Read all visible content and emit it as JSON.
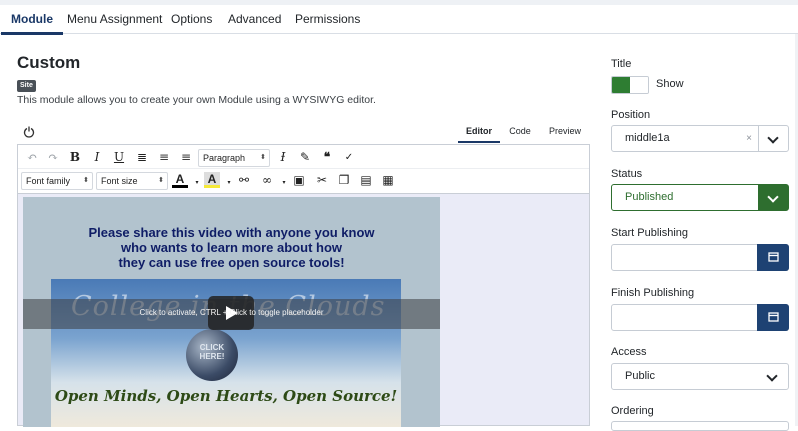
{
  "tabs": [
    {
      "label": "Module",
      "active": true
    },
    {
      "label": "Menu Assignment"
    },
    {
      "label": "Options"
    },
    {
      "label": "Advanced"
    },
    {
      "label": "Permissions"
    }
  ],
  "module": {
    "title": "Custom",
    "badge": "Site",
    "description": "This module allows you to create your own Module using a WYSIWYG editor."
  },
  "editor": {
    "tabs": {
      "editor": "Editor",
      "code": "Code",
      "preview": "Preview"
    },
    "block_format": "Paragraph",
    "font_family": "Font family",
    "font_size": "Font size",
    "icons": [
      "undo-icon",
      "redo-icon",
      "bold-icon",
      "italic-icon",
      "underline-icon",
      "align-justify-icon",
      "align-center-icon",
      "align-left-icon",
      "clear-format-icon",
      "brush-icon",
      "blockquote-icon",
      "spellcheck-icon",
      "text-color-icon",
      "background-color-icon",
      "unlink-icon",
      "link-icon",
      "image-icon",
      "cut-icon",
      "copy-icon",
      "paste-icon",
      "paste-text-icon",
      "power-icon"
    ],
    "content": {
      "share_text_1": "Please share this video with anyone you know",
      "share_text_2": "who wants to learn more about how",
      "share_text_3": "they can use free open source tools!",
      "video_title_text": "College in the Clouds",
      "globe_text_1": "CLICK",
      "globe_text_2": "HERE!",
      "motto": "Open Minds, Open Hearts, Open Source!",
      "placeholder_hint": "Click to activate, CTRL + Click to toggle placeholder"
    }
  },
  "sidebar": {
    "title_label": "Title",
    "show_label": "Show",
    "show_enabled": true,
    "position_label": "Position",
    "position_value": "middle1a",
    "clear_symbol": "×",
    "status_label": "Status",
    "status_value": "Published",
    "start_label": "Start Publishing",
    "finish_label": "Finish Publishing",
    "access_label": "Access",
    "access_value": "Public",
    "ordering_label": "Ordering"
  },
  "colors": {
    "accent": "#1a3867",
    "published_green": "#2e6e2f",
    "calendar_button": "#1e4273"
  }
}
